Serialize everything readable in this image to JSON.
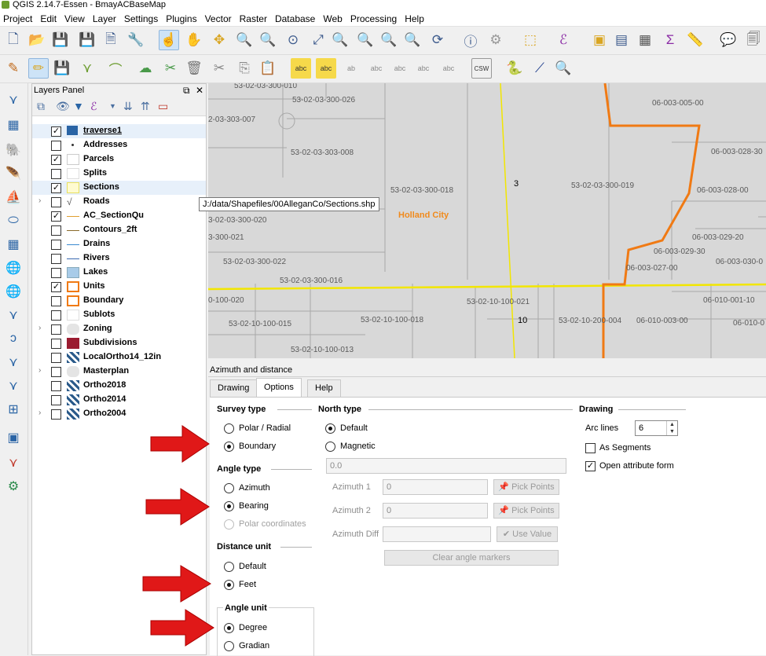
{
  "window": {
    "title": "QGIS 2.14.7-Essen - BmayACBaseMap"
  },
  "menu": [
    "Project",
    "Edit",
    "View",
    "Layer",
    "Settings",
    "Plugins",
    "Vector",
    "Raster",
    "Database",
    "Web",
    "Processing",
    "Help"
  ],
  "layers_panel": {
    "title": "Layers Panel",
    "layers": [
      {
        "name": "traverse1",
        "checked": true,
        "expandable": false,
        "selected": true
      },
      {
        "name": "Addresses",
        "checked": false,
        "expandable": false
      },
      {
        "name": "Parcels",
        "checked": true,
        "expandable": false
      },
      {
        "name": "Splits",
        "checked": false,
        "expandable": false
      },
      {
        "name": "Sections",
        "checked": true,
        "expandable": false,
        "hover": true
      },
      {
        "name": "Roads",
        "checked": false,
        "expandable": true
      },
      {
        "name": "AC_SectionQu",
        "checked": true,
        "expandable": false
      },
      {
        "name": "Contours_2ft",
        "checked": false,
        "expandable": false
      },
      {
        "name": "Drains",
        "checked": false,
        "expandable": false
      },
      {
        "name": "Rivers",
        "checked": false,
        "expandable": false
      },
      {
        "name": "Lakes",
        "checked": false,
        "expandable": false
      },
      {
        "name": "Units",
        "checked": true,
        "expandable": false
      },
      {
        "name": "Boundary",
        "checked": false,
        "expandable": false
      },
      {
        "name": "Sublots",
        "checked": false,
        "expandable": false
      },
      {
        "name": "Zoning",
        "checked": false,
        "expandable": true
      },
      {
        "name": "Subdivisions",
        "checked": false,
        "expandable": false
      },
      {
        "name": "LocalOrtho14_12in",
        "checked": false,
        "expandable": false
      },
      {
        "name": "Masterplan",
        "checked": false,
        "expandable": true
      },
      {
        "name": "Ortho2018",
        "checked": false,
        "expandable": false
      },
      {
        "name": "Ortho2014",
        "checked": false,
        "expandable": false
      },
      {
        "name": "Ortho2004",
        "checked": false,
        "expandable": true
      }
    ],
    "tooltip": "J:/data/Shapefiles/00AlleganCo/Sections.shp"
  },
  "map": {
    "city_label": "Holland City",
    "section_numbers": [
      "3",
      "10"
    ],
    "parcel_labels": [
      "53-02-03-300-010",
      "53-02-03-300-026",
      "2-03-303-007",
      "53-02-03-303-008",
      "53-02-03-300-018",
      "53-02-03-300-019",
      "3-02-03-300-020",
      "3-300-021",
      "53-02-03-300-022",
      "53-02-03-300-016",
      "0-100-020",
      "53-02-10-100-021",
      "53-02-10-100-015",
      "53-02-10-100-018",
      "53-02-10-200-004",
      "53-02-10-100-013",
      "06-003-005-00",
      "06-003-028-30",
      "06-003-028-00",
      "06-003-029-20",
      "06-003-029-30",
      "06-003-030-0",
      "06-003-027-00",
      "06-010-001-10",
      "06-010-003-00",
      "06-010-0"
    ]
  },
  "dock": {
    "title": "Azimuth and distance",
    "tabs": [
      {
        "label": "Drawing",
        "active": false
      },
      {
        "label": "Options",
        "active": true
      },
      {
        "label": "Help",
        "active": false
      }
    ],
    "survey_type": {
      "title": "Survey type",
      "options": [
        {
          "label": "Polar / Radial",
          "selected": false
        },
        {
          "label": "Boundary",
          "selected": true
        }
      ]
    },
    "angle_type": {
      "title": "Angle type",
      "options": [
        {
          "label": "Azimuth",
          "selected": false
        },
        {
          "label": "Bearing",
          "selected": true
        },
        {
          "label": "Polar coordinates",
          "selected": false,
          "disabled": true
        }
      ]
    },
    "distance_unit": {
      "title": "Distance unit",
      "options": [
        {
          "label": "Default",
          "selected": false
        },
        {
          "label": "Feet",
          "selected": true
        }
      ]
    },
    "angle_unit": {
      "title": "Angle unit",
      "options": [
        {
          "label": "Degree",
          "selected": true
        },
        {
          "label": "Gradian",
          "selected": false
        }
      ]
    },
    "north_type": {
      "title": "North type",
      "options": [
        {
          "label": "Default",
          "selected": true
        },
        {
          "label": "Magnetic",
          "selected": false
        }
      ],
      "magnetic_value": "0.0",
      "azimuth1_label": "Azimuth 1",
      "azimuth1_value": "0",
      "azimuth2_label": "Azimuth 2",
      "azimuth2_value": "0",
      "azimuth_diff_label": "Azimuth Diff",
      "azimuth_diff_value": "",
      "pick_points_label": "Pick Points",
      "use_value_label": "Use Value",
      "clear_label": "Clear angle markers"
    },
    "drawing": {
      "title": "Drawing",
      "arc_lines_label": "Arc lines",
      "arc_lines_value": "6",
      "as_segments_label": "As Segments",
      "as_segments_checked": false,
      "open_attr_label": "Open attribute form",
      "open_attr_checked": true
    }
  },
  "colors": {
    "annotation_arrow": "#e01818",
    "city_label": "#f08a1c",
    "boundary_line": "#f07a14",
    "section_line": "#f2e600"
  }
}
